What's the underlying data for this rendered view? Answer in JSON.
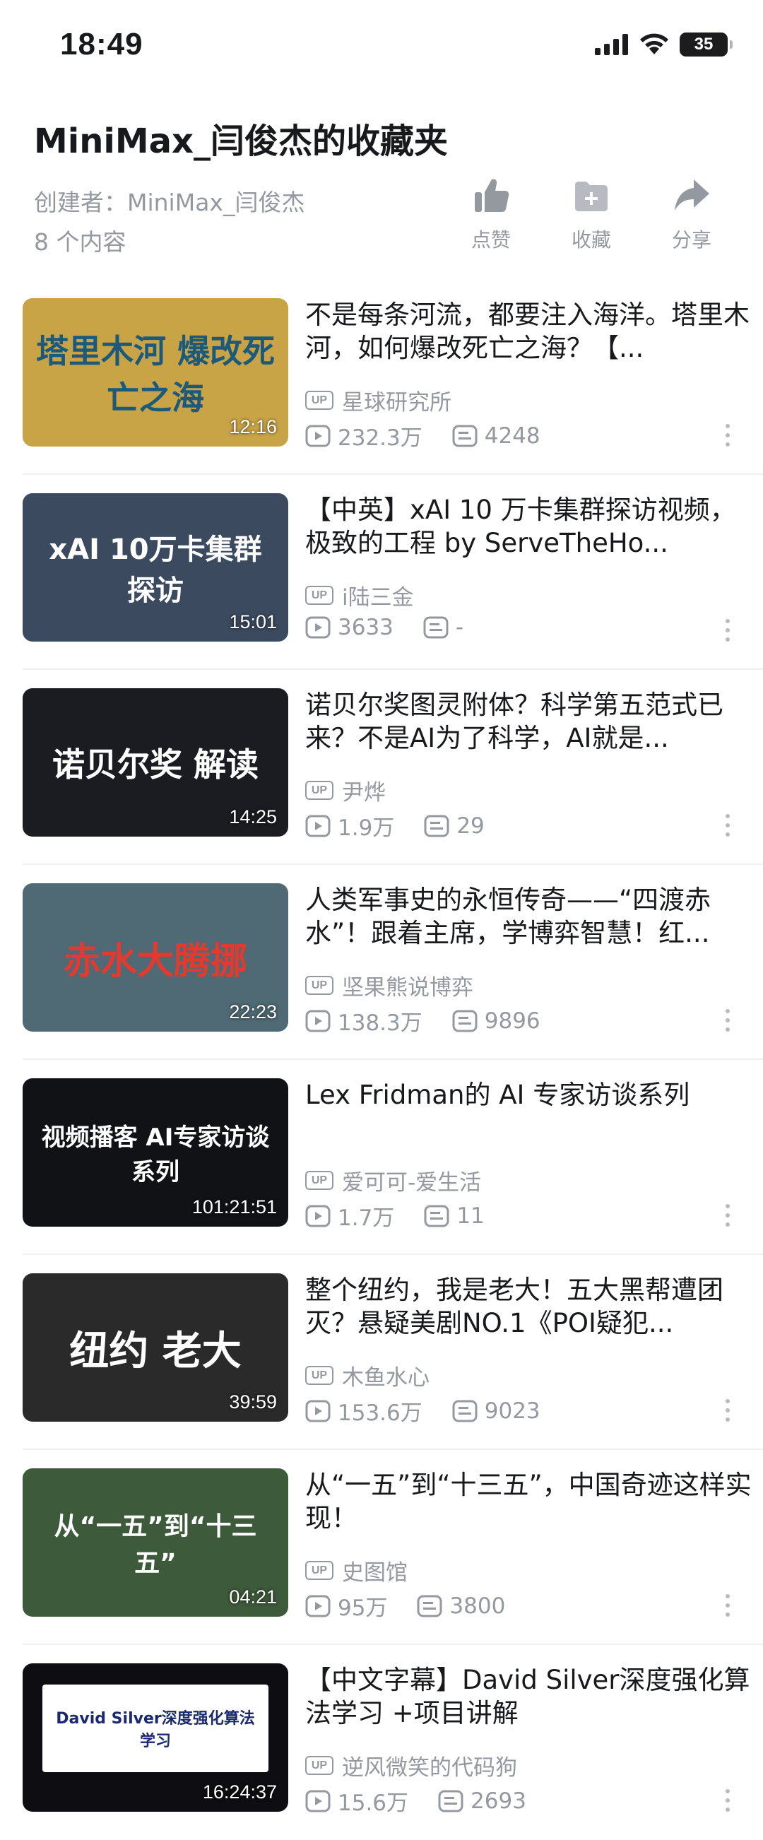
{
  "status_bar": {
    "time": "18:49",
    "battery": "35"
  },
  "header": {
    "title": "MiniMax_闫俊杰的收藏夹",
    "creator": "创建者：MiniMax_闫俊杰",
    "count": "8 个内容",
    "actions": [
      {
        "label": "点赞",
        "icon": "thumbs-up-icon"
      },
      {
        "label": "收藏",
        "icon": "folder-plus-icon"
      },
      {
        "label": "分享",
        "icon": "share-arrow-icon"
      }
    ]
  },
  "up_badge": "UP",
  "videos": [
    {
      "title": "不是每条河流，都要注入海洋。塔里木河，如何爆改死亡之海？【...",
      "uploader": "星球研究所",
      "views": "232.3万",
      "danmaku": "4248",
      "duration": "12:16",
      "thumb_text": "塔里木河 爆改死亡之海",
      "thumb_bg": "#c9a447"
    },
    {
      "title": "【中英】xAI 10 万卡集群探访视频，极致的工程 by ServeTheHo...",
      "uploader": "i陆三金",
      "views": "3633",
      "danmaku": "-",
      "duration": "15:01",
      "thumb_text": "xAI 10万卡集群 探访",
      "thumb_bg": "#3b4a5e"
    },
    {
      "title": "诺贝尔奖图灵附体？科学第五范式已来？不是AI为了科学，AI就是...",
      "uploader": "尹烨",
      "views": "1.9万",
      "danmaku": "29",
      "duration": "14:25",
      "thumb_text": "诺贝尔奖 解读",
      "thumb_bg": "#1a1c22"
    },
    {
      "title": "人类军事史的永恒传奇——“四渡赤水”！跟着主席，学博弈智慧！红...",
      "uploader": "坚果熊说博弈",
      "views": "138.3万",
      "danmaku": "9896",
      "duration": "22:23",
      "thumb_text": "赤水大腾挪",
      "thumb_bg": "#4f6a74"
    },
    {
      "title": "Lex Fridman的 AI 专家访谈系列",
      "uploader": "爱可可-爱生活",
      "views": "1.7万",
      "danmaku": "11",
      "duration": "101:21:51",
      "thumb_text": "视频播客 AI专家访谈系列",
      "thumb_bg": "#111216"
    },
    {
      "title": "整个纽约，我是老大！五大黑帮遭团灭？悬疑美剧NO.1《POI疑犯...",
      "uploader": "木鱼水心",
      "views": "153.6万",
      "danmaku": "9023",
      "duration": "39:59",
      "thumb_text": "纽约 老大",
      "thumb_bg": "#2a2a2a"
    },
    {
      "title": "从“一五”到“十三五”，中国奇迹这样实现！",
      "uploader": "史图馆",
      "views": "95万",
      "danmaku": "3800",
      "duration": "04:21",
      "thumb_text": "从“一五”到“十三五”",
      "thumb_bg": "#3d5a3a"
    },
    {
      "title": "【中文字幕】David Silver深度强化算法学习 +项目讲解",
      "uploader": "逆风微笑的代码狗",
      "views": "15.6万",
      "danmaku": "2693",
      "duration": "16:24:37",
      "thumb_text": "David Silver深度强化算法学习",
      "thumb_bg": "#0e0e12"
    }
  ]
}
